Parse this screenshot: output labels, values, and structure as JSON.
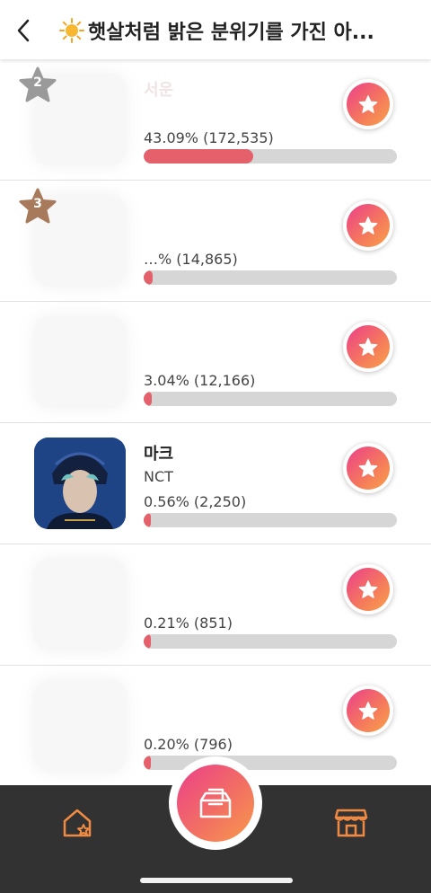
{
  "header": {
    "title": "햇살처럼 밝은 분위기를 가진 아..."
  },
  "entries": [
    {
      "rank": "2",
      "name": "서운",
      "group": "",
      "stat": "43.09% (172,535)",
      "share": 43.09
    },
    {
      "rank": "3",
      "name": "",
      "group": "",
      "stat": "…% (14,865)",
      "share": 3.71
    },
    {
      "rank": "",
      "name": "",
      "group": "",
      "stat": "3.04% (12,166)",
      "share": 3.04
    },
    {
      "rank": "",
      "name": "마크",
      "group": "NCT",
      "stat": "0.56% (2,250)",
      "share": 0.56
    },
    {
      "rank": "",
      "name": "",
      "group": "",
      "stat": "0.21% (851)",
      "share": 0.21
    },
    {
      "rank": "",
      "name": "",
      "group": "",
      "stat": "0.20% (796)",
      "share": 0.2
    }
  ],
  "colors": {
    "bar_fill": "#e4606a",
    "bar_track": "#d6d6d6",
    "accent_gradient_start": "#ec3f8a",
    "accent_gradient_end": "#f8a24a",
    "bottom_bar": "#323232",
    "nav_icon": "#f08a42",
    "badge_silver": "#9a9a9a",
    "badge_bronze": "#a87a5c"
  },
  "icons": {
    "back": "chevron-left-icon",
    "title": "sun-icon",
    "vote": "star-icon",
    "home": "home-star-icon",
    "vote_box": "ballot-box-icon",
    "store": "store-icon"
  }
}
